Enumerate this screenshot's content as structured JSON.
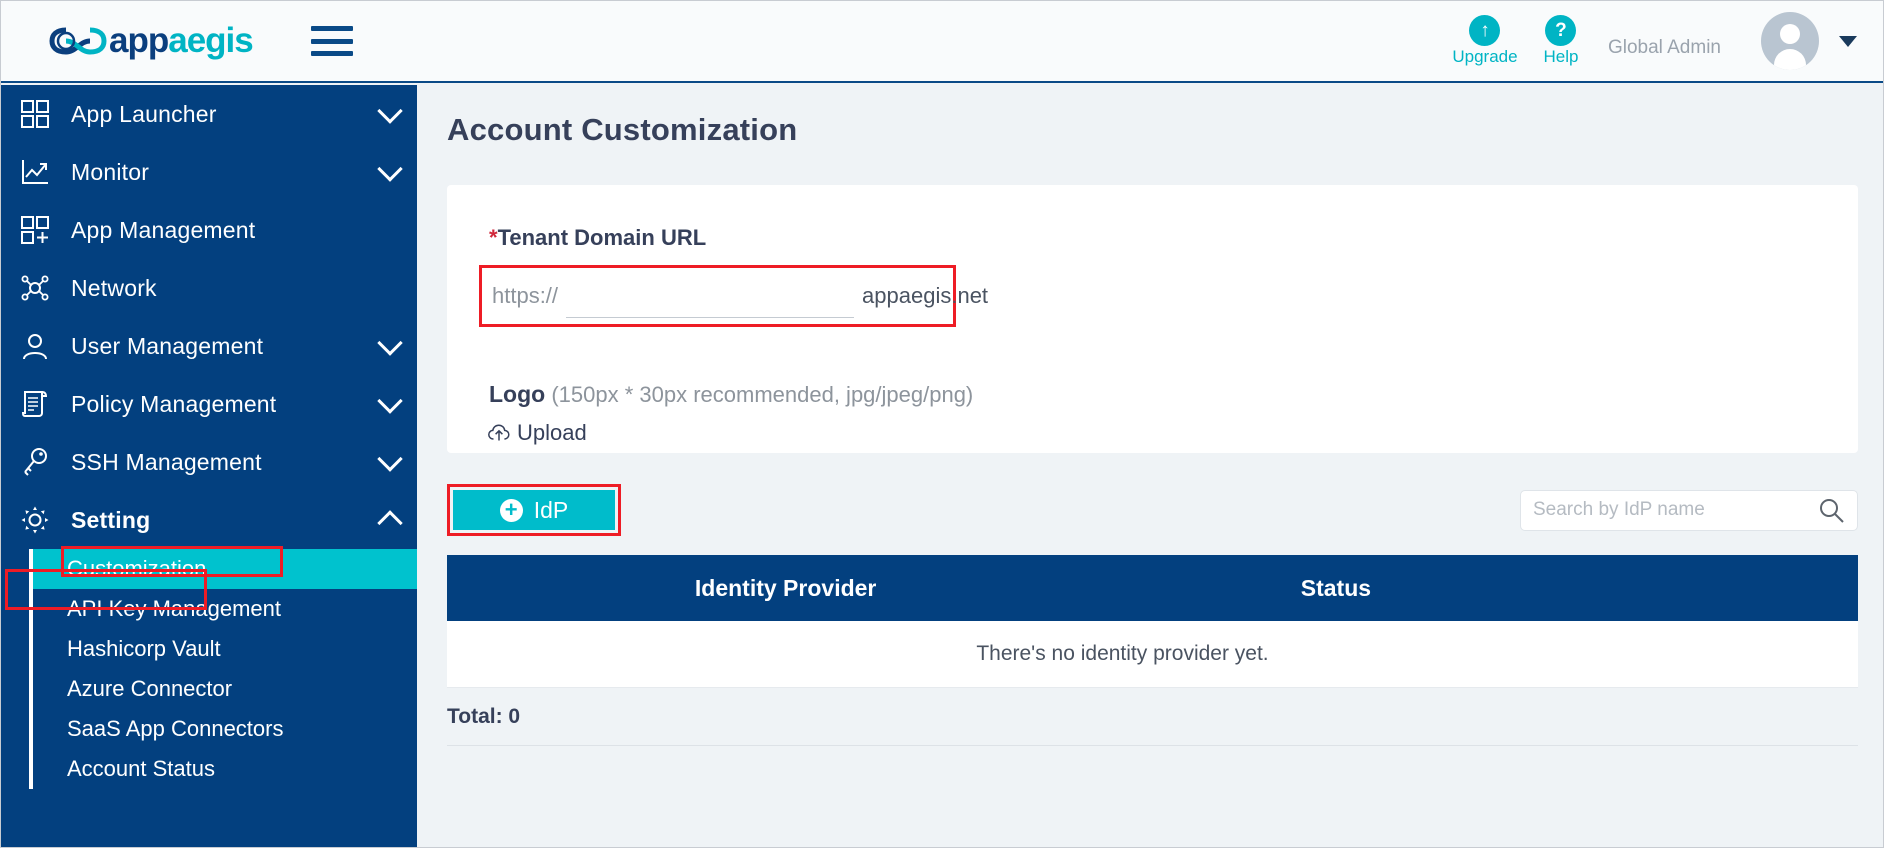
{
  "header": {
    "brand_dark": "app",
    "brand_teal": "aegis",
    "menu_icon": "hamburger-icon",
    "upgrade": {
      "label": "Upgrade",
      "icon": "arrow-up-icon",
      "glyph": "↑"
    },
    "help": {
      "label": "Help",
      "icon": "question-mark-icon",
      "glyph": "?"
    },
    "role": "Global Admin",
    "avatar_icon": "user-avatar-icon",
    "caret_icon": "chevron-down-icon"
  },
  "sidebar": {
    "items": [
      {
        "label": "App Launcher",
        "icon": "grid-icon",
        "expandable": true,
        "expanded": false
      },
      {
        "label": "Monitor",
        "icon": "chart-line-icon",
        "expandable": true,
        "expanded": false
      },
      {
        "label": "App Management",
        "icon": "grid-plus-icon",
        "expandable": false,
        "expanded": false
      },
      {
        "label": "Network",
        "icon": "network-nodes-icon",
        "expandable": false,
        "expanded": false
      },
      {
        "label": "User Management",
        "icon": "user-icon",
        "expandable": true,
        "expanded": false
      },
      {
        "label": "Policy Management",
        "icon": "document-scroll-icon",
        "expandable": true,
        "expanded": false
      },
      {
        "label": "SSH Management",
        "icon": "key-icon",
        "expandable": true,
        "expanded": false
      },
      {
        "label": "Setting",
        "icon": "gear-icon",
        "expandable": true,
        "expanded": true
      }
    ],
    "submenu": [
      {
        "label": "Customization",
        "active": true
      },
      {
        "label": "API Key Management",
        "active": false
      },
      {
        "label": "Hashicorp Vault",
        "active": false
      },
      {
        "label": "Azure Connector",
        "active": false
      },
      {
        "label": "SaaS App Connectors",
        "active": false
      },
      {
        "label": "Account Status",
        "active": false
      }
    ]
  },
  "main": {
    "page_title": "Account Customization",
    "domain": {
      "required_mark": "*",
      "label": "Tenant Domain URL",
      "protocol": "https://",
      "value": "",
      "placeholder": "",
      "suffix": "appaegis.net"
    },
    "logo": {
      "label": "Logo",
      "hint": "(150px * 30px recommended, jpg/jpeg/png)",
      "upload_label": "Upload",
      "upload_icon": "cloud-upload-icon"
    },
    "toolbar": {
      "idp_button": "IdP",
      "idp_icon": "plus-circle-icon",
      "search_placeholder": "Search by IdP name",
      "search_value": "",
      "search_icon": "search-icon"
    },
    "table": {
      "columns": [
        "Identity Provider",
        "Status"
      ],
      "empty_message": "There's no identity provider yet.",
      "rows": [],
      "total_label": "Total: 0"
    }
  },
  "colors": {
    "sidebar_blue": "#03407f",
    "accent_teal": "#00bccb",
    "highlight_red": "#ee1c25",
    "page_bg": "#eff3f6"
  }
}
